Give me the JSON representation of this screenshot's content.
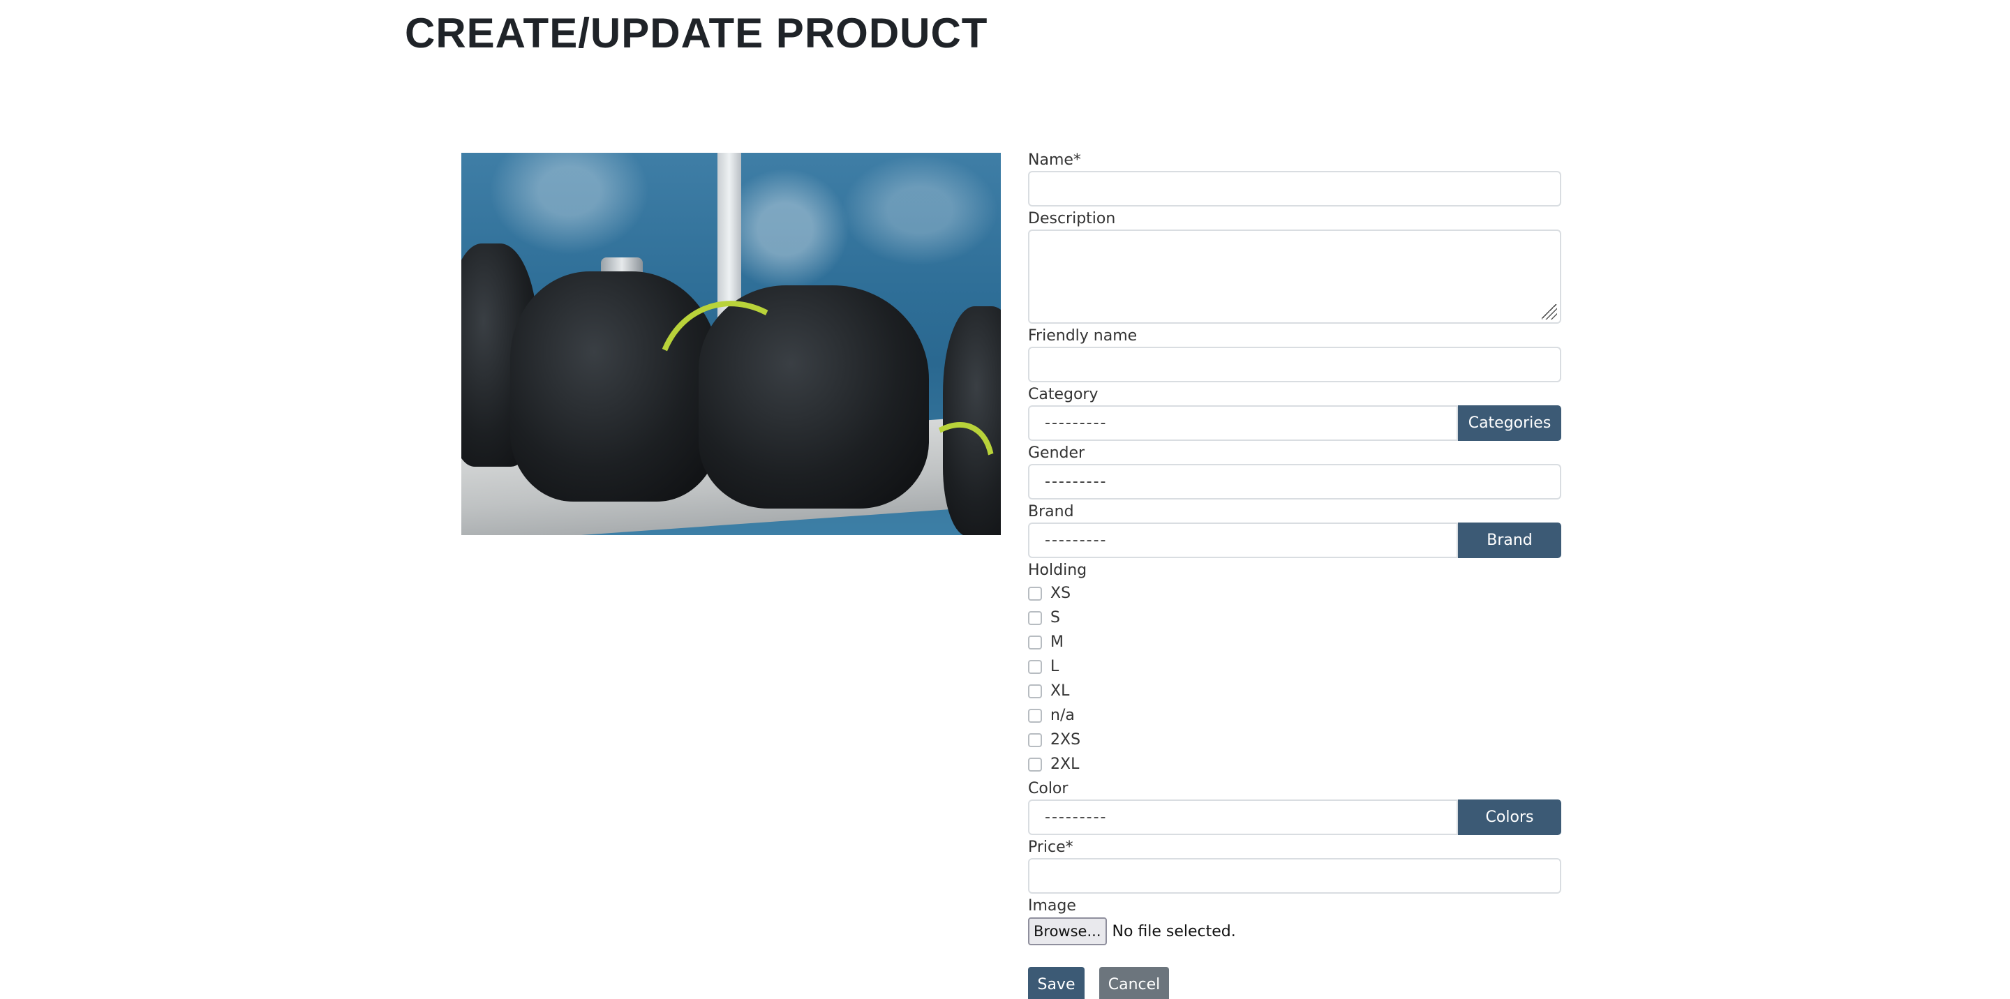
{
  "page": {
    "title": "CREATE/UPDATE PRODUCT"
  },
  "image_preview": {
    "alt": "Scuba diving BCD vests with regulators on a boat bench"
  },
  "form": {
    "name": {
      "label": "Name*",
      "value": ""
    },
    "description": {
      "label": "Description",
      "value": ""
    },
    "friendly_name": {
      "label": "Friendly name",
      "value": ""
    },
    "category": {
      "label": "Category",
      "selected": "---------",
      "button": "Categories"
    },
    "gender": {
      "label": "Gender",
      "selected": "---------"
    },
    "brand": {
      "label": "Brand",
      "selected": "---------",
      "button": "Brand"
    },
    "holding": {
      "label": "Holding",
      "options": [
        {
          "label": "XS",
          "checked": false
        },
        {
          "label": "S",
          "checked": false
        },
        {
          "label": "M",
          "checked": false
        },
        {
          "label": "L",
          "checked": false
        },
        {
          "label": "XL",
          "checked": false
        },
        {
          "label": "n/a",
          "checked": false
        },
        {
          "label": "2XS",
          "checked": false
        },
        {
          "label": "2XL",
          "checked": false
        }
      ]
    },
    "color": {
      "label": "Color",
      "selected": "---------",
      "button": "Colors"
    },
    "price": {
      "label": "Price*",
      "value": ""
    },
    "image": {
      "label": "Image",
      "browse_label": "Browse...",
      "status": "No file selected."
    },
    "save_label": "Save",
    "cancel_label": "Cancel"
  },
  "colors": {
    "primary_button": "#3c5a75",
    "secondary_button": "#6c757d",
    "input_border": "#d9dde1"
  }
}
